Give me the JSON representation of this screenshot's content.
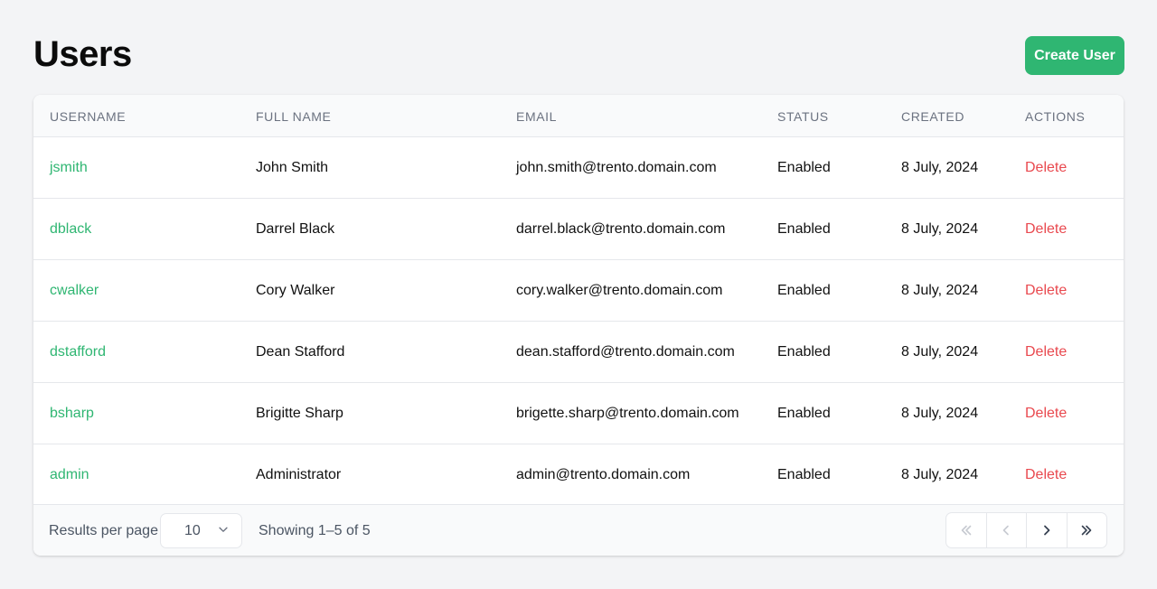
{
  "header": {
    "title": "Users",
    "create_label": "Create User"
  },
  "table": {
    "columns": [
      "USERNAME",
      "FULL NAME",
      "EMAIL",
      "STATUS",
      "CREATED",
      "ACTIONS"
    ],
    "rows": [
      {
        "username": "jsmith",
        "full_name": "John Smith",
        "email": "john.smith@trento.domain.com",
        "status": "Enabled",
        "created": "8 July, 2024",
        "action": "Delete"
      },
      {
        "username": "dblack",
        "full_name": "Darrel Black",
        "email": "darrel.black@trento.domain.com",
        "status": "Enabled",
        "created": "8 July, 2024",
        "action": "Delete"
      },
      {
        "username": "cwalker",
        "full_name": "Cory Walker",
        "email": "cory.walker@trento.domain.com",
        "status": "Enabled",
        "created": "8 July, 2024",
        "action": "Delete"
      },
      {
        "username": "dstafford",
        "full_name": "Dean Stafford",
        "email": "dean.stafford@trento.domain.com",
        "status": "Enabled",
        "created": "8 July, 2024",
        "action": "Delete"
      },
      {
        "username": "bsharp",
        "full_name": "Brigitte Sharp",
        "email": "brigette.sharp@trento.domain.com",
        "status": "Enabled",
        "created": "8 July, 2024",
        "action": "Delete"
      },
      {
        "username": "admin",
        "full_name": "Administrator",
        "email": "admin@trento.domain.com",
        "status": "Enabled",
        "created": "8 July, 2024",
        "action": "Delete"
      }
    ]
  },
  "footer": {
    "results_per_page_label": "Results per page",
    "results_per_page_value": "10",
    "showing": "Showing 1–5 of 5",
    "pager_icons": [
      "double-chevron-left-icon",
      "chevron-left-icon",
      "chevron-right-icon",
      "double-chevron-right-icon"
    ]
  },
  "colors": {
    "accent": "#2fb672",
    "danger": "#e9494f",
    "background": "#f3f4f6"
  }
}
